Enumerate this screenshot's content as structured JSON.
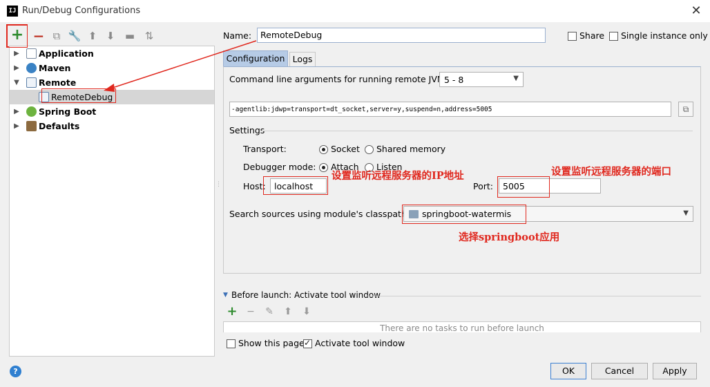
{
  "window": {
    "title": "Run/Debug Configurations",
    "app_icon_text": "IJ"
  },
  "toolbar": {
    "add": "+",
    "remove": "−"
  },
  "tree": {
    "items": [
      {
        "label": "Application",
        "icon": "application-icon"
      },
      {
        "label": "Maven",
        "icon": "maven-icon"
      },
      {
        "label": "Remote",
        "icon": "remote-icon"
      },
      {
        "label": "RemoteDebug",
        "icon": "remote-config-icon"
      },
      {
        "label": "Spring Boot",
        "icon": "spring-boot-icon"
      },
      {
        "label": "Defaults",
        "icon": "defaults-icon"
      }
    ]
  },
  "name": {
    "label": "Name:",
    "value": "RemoteDebug"
  },
  "share": {
    "label": "Share",
    "checked": false
  },
  "single_instance": {
    "label": "Single instance only",
    "checked": false
  },
  "tabs": [
    {
      "label": "Configuration",
      "active": true
    },
    {
      "label": "Logs",
      "active": false
    }
  ],
  "config": {
    "cmd_label": "Command line arguments for running remote JVM",
    "jvm_version": "5 - 8",
    "agent_args": "-agentlib:jdwp=transport=dt_socket,server=y,suspend=n,address=5005",
    "settings_label": "Settings",
    "transport_label": "Transport:",
    "transport_options": [
      "Socket",
      "Shared memory"
    ],
    "transport_selected": "Socket",
    "debugger_mode_label": "Debugger mode:",
    "debugger_mode_options": [
      "Attach",
      "Listen"
    ],
    "debugger_mode_selected": "Attach",
    "host_label": "Host:",
    "host_value": "localhost",
    "port_label": "Port:",
    "port_value": "5005",
    "module_label": "Search sources using module's classpath:",
    "module_value": "springboot-watermis"
  },
  "before_launch": {
    "label": "Before launch: Activate tool window",
    "empty_text": "There are no tasks to run before launch"
  },
  "show_page": {
    "label": "Show this page",
    "checked": false
  },
  "activate_window": {
    "label": "Activate tool window",
    "checked": true
  },
  "buttons": {
    "ok": "OK",
    "cancel": "Cancel",
    "apply": "Apply",
    "help": "?"
  },
  "annotations": {
    "host_note": "设置监听远程服务器的IP地址",
    "port_note": "设置监听远程服务器的端口",
    "module_note": "选择springboot应用",
    "color": "#e0281e"
  }
}
